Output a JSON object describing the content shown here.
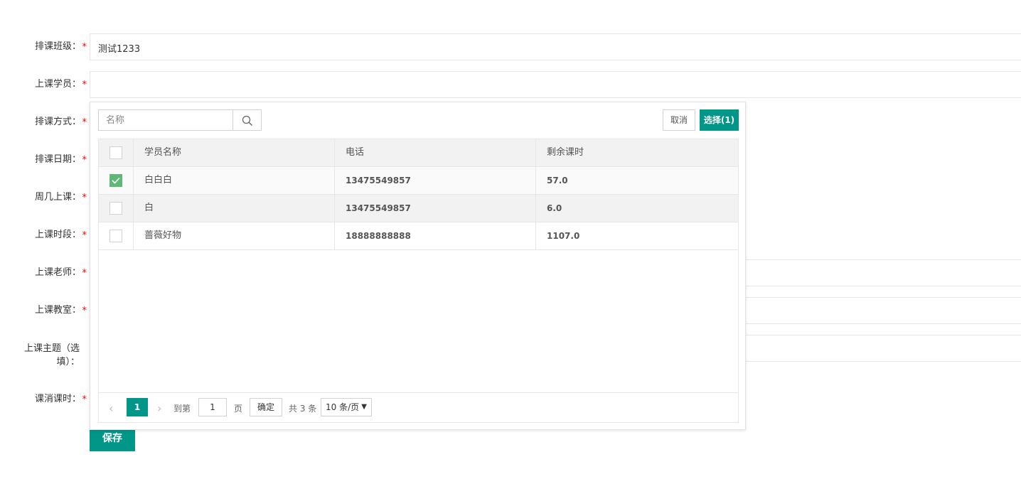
{
  "form": {
    "labels": {
      "class": "排课班级：",
      "students": "上课学员：",
      "mode": "排课方式：",
      "date": "排课日期：",
      "weekday": "周几上课：",
      "period": "上课时段：",
      "teacher": "上课老师：",
      "room": "上课教室：",
      "topic_line1": "上课主题（选",
      "topic_line2": "填）：",
      "hours": "课消课时："
    },
    "required_mark": "*",
    "class_value": "测试1233",
    "save_label": "保存"
  },
  "popup": {
    "search_placeholder": "名称",
    "cancel_label": "取消",
    "select_label": "选择(1)",
    "columns": [
      "学员名称",
      "电话",
      "剩余课时"
    ],
    "rows": [
      {
        "name": "白白白",
        "phone": "13475549857",
        "hours": "57.0",
        "checked": true
      },
      {
        "name": "白",
        "phone": "13475549857",
        "hours": "6.0",
        "checked": false
      },
      {
        "name": "蔷薇好物",
        "phone": "18888888888",
        "hours": "1107.0",
        "checked": false
      }
    ],
    "pager": {
      "current_page": "1",
      "goto_label": "到第",
      "goto_value": "1",
      "page_unit": "页",
      "confirm_label": "确定",
      "total_label": "共 3 条",
      "page_size": "10 条/页"
    }
  },
  "colors": {
    "accent": "#009688",
    "checked": "#5fb878",
    "required": "#ff0000"
  },
  "icons": {
    "search": "search-icon",
    "prev": "chevron-left-icon",
    "next": "chevron-right-icon",
    "dropdown": "caret-down-icon",
    "check": "check-icon"
  }
}
